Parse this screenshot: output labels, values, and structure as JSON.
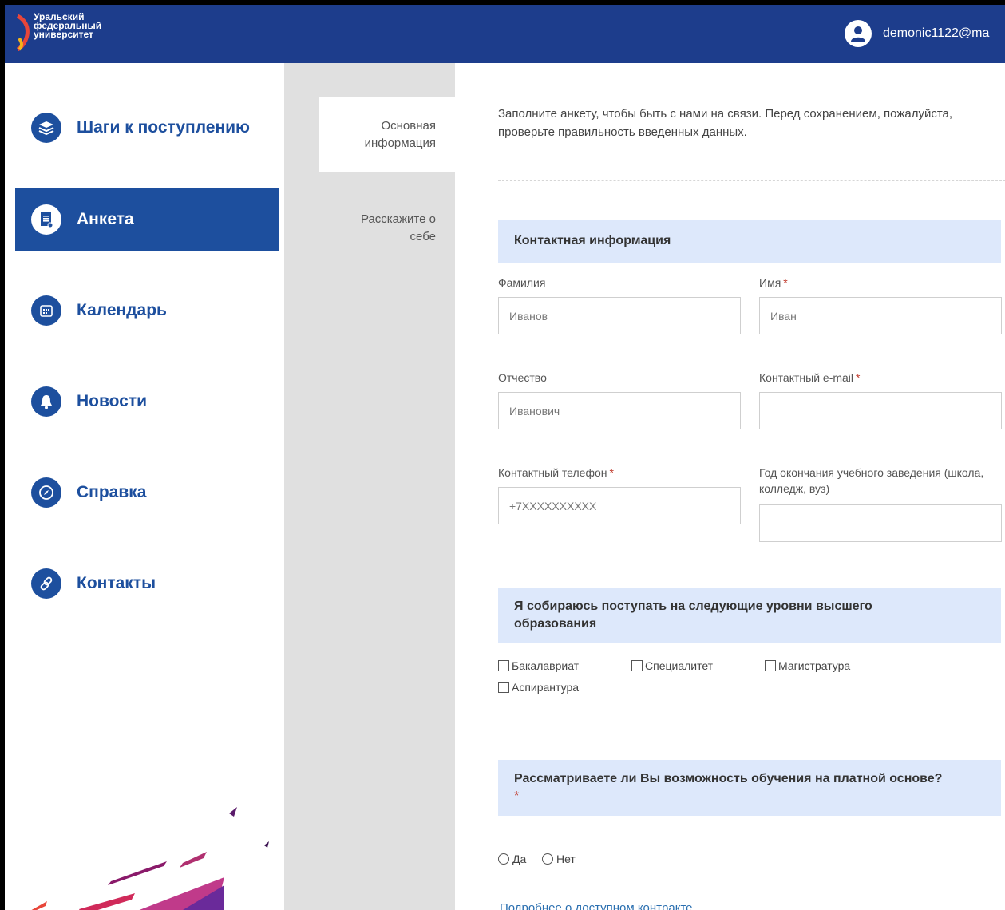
{
  "header": {
    "logo_lines": [
      "Уральский",
      "федеральный",
      "университет"
    ],
    "username": "demonic1122@ma"
  },
  "sidebar": {
    "items": [
      {
        "label": "Шаги к поступлению",
        "icon": "stack-icon",
        "active": false
      },
      {
        "label": "Анкета",
        "icon": "document-icon",
        "active": true
      },
      {
        "label": "Календарь",
        "icon": "calendar-icon",
        "active": false
      },
      {
        "label": "Новости",
        "icon": "bell-icon",
        "active": false
      },
      {
        "label": "Справка",
        "icon": "compass-icon",
        "active": false
      },
      {
        "label": "Контакты",
        "icon": "link-icon",
        "active": false
      }
    ]
  },
  "tabs": {
    "active": "Основная информация",
    "inactive": "Расскажите о себе"
  },
  "form": {
    "intro": "Заполните анкету, чтобы быть с нами на связи. Перед сохранением, пожалуйста, проверьте правильность введенных данных.",
    "contact_section": "Контактная информация",
    "fields": {
      "last_name": {
        "label": "Фамилия",
        "placeholder": "Иванов"
      },
      "first_name": {
        "label": "Имя",
        "placeholder": "Иван"
      },
      "patronymic": {
        "label": "Отчество",
        "placeholder": "Иванович"
      },
      "email": {
        "label": "Контактный e-mail",
        "placeholder": ""
      },
      "phone": {
        "label": "Контактный телефон",
        "placeholder": "+7XXXXXXXXXX"
      },
      "grad_year": {
        "label": "Год окончания учебного заведения (школа, колледж, вуз)",
        "placeholder": ""
      }
    },
    "required_mark": "*",
    "levels_section": "Я собираюсь поступать на следующие уровни высшего образования",
    "levels": [
      "Бакалавриат",
      "Специалитет",
      "Магистратура",
      "Аспирантура"
    ],
    "paid_section": "Рассматриваете ли Вы возможность обучения на платной основе?",
    "paid_options": [
      "Да",
      "Нет"
    ],
    "contract_link": "Подробнее о доступном контракте"
  },
  "colors": {
    "header_bg": "#1d3d8c",
    "accent": "#1d4f9e",
    "section_bg": "#dde8fb",
    "tabs_bg": "#e0e0e0",
    "required": "#c0392b"
  }
}
